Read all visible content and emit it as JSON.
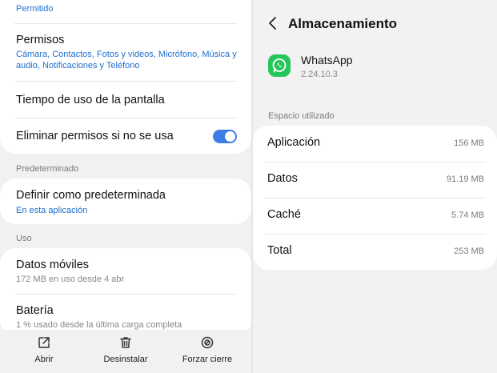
{
  "left": {
    "top_status": "Permitido",
    "permissions": {
      "title": "Permisos",
      "detail": "Cámara, Contactos, Fotos y videos, Micrófono, Música y audio, Notificaciones y Teléfono"
    },
    "screen_time": {
      "title": "Tiempo de uso de la pantalla"
    },
    "remove_permissions": {
      "title": "Eliminar permisos si no se usa",
      "enabled": true
    },
    "section_default": "Predeterminado",
    "set_default": {
      "title": "Definir como predeterminada",
      "detail": "En esta aplicación"
    },
    "section_usage": "Uso",
    "mobile_data": {
      "title": "Datos móviles",
      "detail": "172 MB en uso desde 4 abr"
    },
    "battery": {
      "title": "Batería",
      "detail": "1 % usado desde la última carga completa"
    },
    "bottom_actions": {
      "open": "Abrir",
      "uninstall": "Desinstalar",
      "force_stop": "Forzar cierre"
    }
  },
  "right": {
    "title": "Almacenamiento",
    "app": {
      "name": "WhatsApp",
      "version": "2.24.10.3"
    },
    "section": "Espacio utilizado",
    "rows": [
      {
        "label": "Aplicación",
        "value": "156 MB"
      },
      {
        "label": "Datos",
        "value": "91.19 MB"
      },
      {
        "label": "Caché",
        "value": "5.74 MB"
      },
      {
        "label": "Total",
        "value": "253 MB"
      }
    ]
  },
  "colors": {
    "accent": "#3e7de6",
    "link": "#1e6fd0",
    "whatsapp": "#26c75a"
  }
}
